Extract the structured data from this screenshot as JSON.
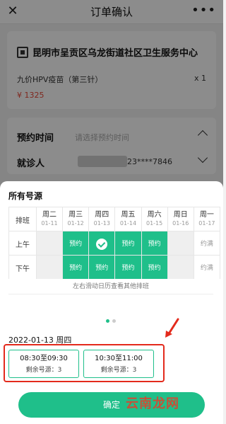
{
  "nav": {
    "title": "订单确认",
    "close_icon": "close-icon",
    "more_glyph": "•••"
  },
  "order": {
    "hospital": "昆明市呈贡区乌龙街道社区卫生服务中心",
    "vaccine": "九价HPV疫苗（第三针）",
    "quantity": "x 1",
    "price": "¥ 1325"
  },
  "form": {
    "time_label": "预约时间",
    "time_placeholder": "请选择预约时间",
    "patient_label": "就诊人",
    "patient_phone": "23****7846"
  },
  "sheet": {
    "title": "所有号源",
    "schedule_header": "排班",
    "days": [
      {
        "name": "周二",
        "date": "01-11"
      },
      {
        "name": "周三",
        "date": "01-12"
      },
      {
        "name": "周四",
        "date": "01-13"
      },
      {
        "name": "周五",
        "date": "01-14"
      },
      {
        "name": "周六",
        "date": "01-15"
      },
      {
        "name": "周日",
        "date": "01-16"
      },
      {
        "name": "周一",
        "date": "01-17"
      }
    ],
    "rows": [
      {
        "label": "上午",
        "slots": [
          {
            "status": "gray",
            "text": ""
          },
          {
            "status": "avail",
            "text": "预约"
          },
          {
            "status": "selected",
            "text": ""
          },
          {
            "status": "avail",
            "text": "预约"
          },
          {
            "status": "avail",
            "text": "预约"
          },
          {
            "status": "gray",
            "text": ""
          },
          {
            "status": "full",
            "text": "约满"
          }
        ]
      },
      {
        "label": "下午",
        "slots": [
          {
            "status": "gray",
            "text": ""
          },
          {
            "status": "avail",
            "text": "预约"
          },
          {
            "status": "avail",
            "text": "预约"
          },
          {
            "status": "avail",
            "text": "预约"
          },
          {
            "status": "avail",
            "text": "预约"
          },
          {
            "status": "gray",
            "text": ""
          },
          {
            "status": "full",
            "text": "约满"
          }
        ]
      }
    ],
    "hint": "左右滑动日历查看其他排班",
    "selected_date": "2022-01-13 周四",
    "timeslots": [
      {
        "time": "08:30至09:30",
        "remaining": "剩余号源：3"
      },
      {
        "time": "10:30至11:00",
        "remaining": "剩余号源：3"
      }
    ],
    "confirm_label": "确定"
  },
  "watermark": "云南龙网",
  "colors": {
    "accent": "#1fbf8a",
    "highlight": "#e32a1c",
    "price": "#e84a3a"
  }
}
